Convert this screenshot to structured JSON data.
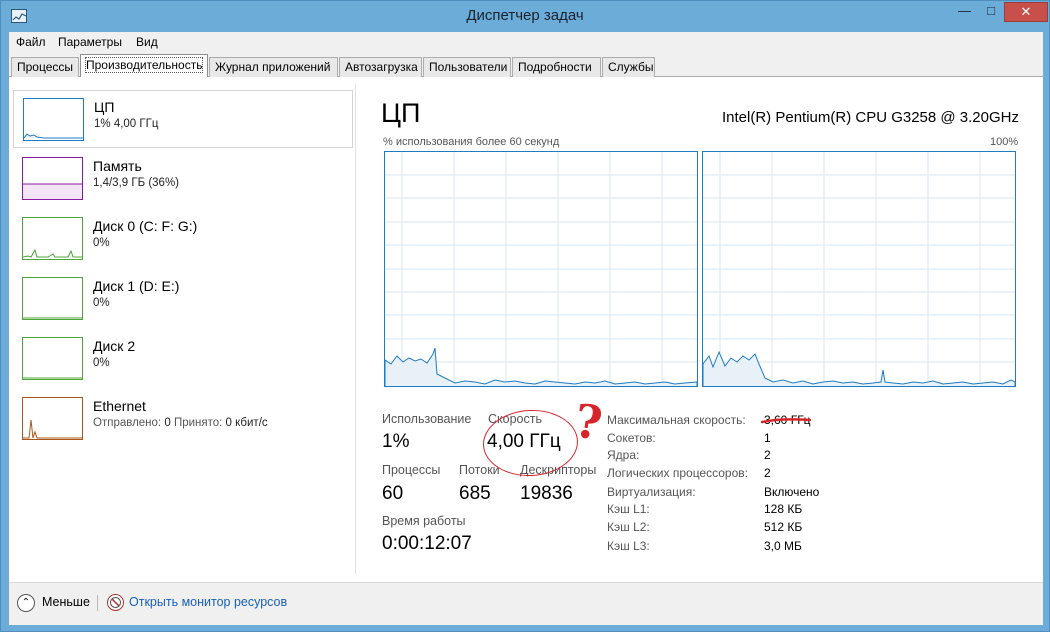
{
  "window": {
    "title": "Диспетчер задач",
    "min_glyph": "—",
    "max_glyph": "□",
    "close_glyph": "✕"
  },
  "menu": {
    "file": "Файл",
    "params": "Параметры",
    "view": "Вид"
  },
  "tabs": [
    {
      "label": "Процессы"
    },
    {
      "label": "Производительность"
    },
    {
      "label": "Журнал приложений"
    },
    {
      "label": "Автозагрузка"
    },
    {
      "label": "Пользователи"
    },
    {
      "label": "Подробности"
    },
    {
      "label": "Службы"
    }
  ],
  "sidebar": {
    "items": [
      {
        "title": "ЦП",
        "sub": "1% 4,00 ГГц"
      },
      {
        "title": "Память",
        "sub": "1,4/3,9 ГБ (36%)"
      },
      {
        "title": "Диск 0 (C: F: G:)",
        "sub": "0%"
      },
      {
        "title": "Диск 1 (D: E:)",
        "sub": "0%"
      },
      {
        "title": "Диск 2",
        "sub": "0%"
      },
      {
        "title": "Ethernet",
        "sent_label": "Отправлено:",
        "sent": "0",
        "recv_label": "Принято:",
        "recv": "0 кбит/с"
      }
    ]
  },
  "cpu": {
    "title": "ЦП",
    "model": "Intel(R) Pentium(R) CPU G3258 @ 3.20GHz",
    "graph_caption": "% использования более 60 секунд",
    "graph_max": "100%",
    "usage_label": "Использование",
    "usage": "1%",
    "speed_label": "Скорость",
    "speed": "4,00 ГГц",
    "processes_label": "Процессы",
    "processes": "60",
    "threads_label": "Потоки",
    "threads": "685",
    "handles_label": "Дескрипторы",
    "handles": "19836",
    "uptime_label": "Время работы",
    "uptime": "0:00:12:07",
    "props": [
      {
        "label": "Максимальная скорость:",
        "value": "3,60 ГГц"
      },
      {
        "label": "Сокетов:",
        "value": "1"
      },
      {
        "label": "Ядра:",
        "value": "2"
      },
      {
        "label": "Логических процессоров:",
        "value": "2"
      },
      {
        "label": "Виртуализация:",
        "value": "Включено"
      },
      {
        "label": "Кэш L1:",
        "value": "128 КБ"
      },
      {
        "label": "Кэш L2:",
        "value": "512 КБ"
      },
      {
        "label": "Кэш L3:",
        "value": "3,0 МБ"
      }
    ]
  },
  "annotation": {
    "question": "?"
  },
  "bottom": {
    "less": "Меньше",
    "monitor": "Открыть монитор ресурсов"
  },
  "colors": {
    "cpu_accent": "#1f7cc2",
    "memory_accent": "#8b1aa7",
    "disk_accent": "#4da43a",
    "ethernet_accent": "#a8561a",
    "annotation": "#d7262b"
  }
}
